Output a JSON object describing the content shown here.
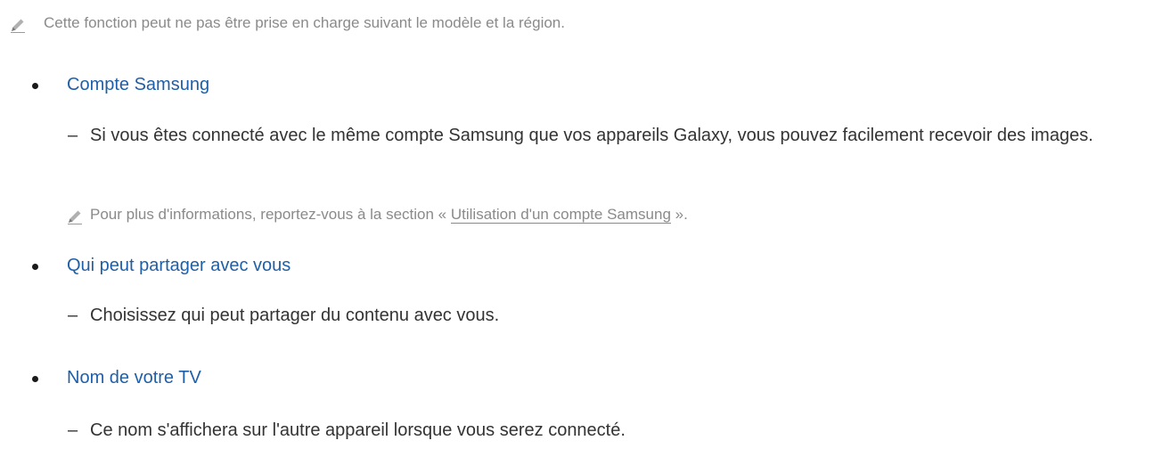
{
  "note_1": {
    "icon": "pencil-icon",
    "text": "Cette fonction peut ne pas être prise en charge suivant le modèle et la région."
  },
  "items": [
    {
      "title": "Compte Samsung",
      "dash": "–",
      "description": "Si vous êtes connecté avec le même compte Samsung que vos appareils Galaxy, vous pouvez facilement recevoir des images."
    },
    {
      "title": "Qui peut partager avec vous",
      "dash": "–",
      "description": "Choisissez qui peut partager du contenu avec vous."
    },
    {
      "title": "Nom de votre TV",
      "dash": "–",
      "description": "Ce nom s'affichera sur l'autre appareil lorsque vous serez connecté."
    }
  ],
  "note_2": {
    "icon": "pencil-icon",
    "prefix": "Pour plus d'informations, reportez-vous à la section «",
    "link": "Utilisation d'un compte Samsung",
    "suffix": "»."
  },
  "colors": {
    "heading": "#1f5fa8",
    "body": "#333333",
    "note": "#8a8a8a"
  }
}
